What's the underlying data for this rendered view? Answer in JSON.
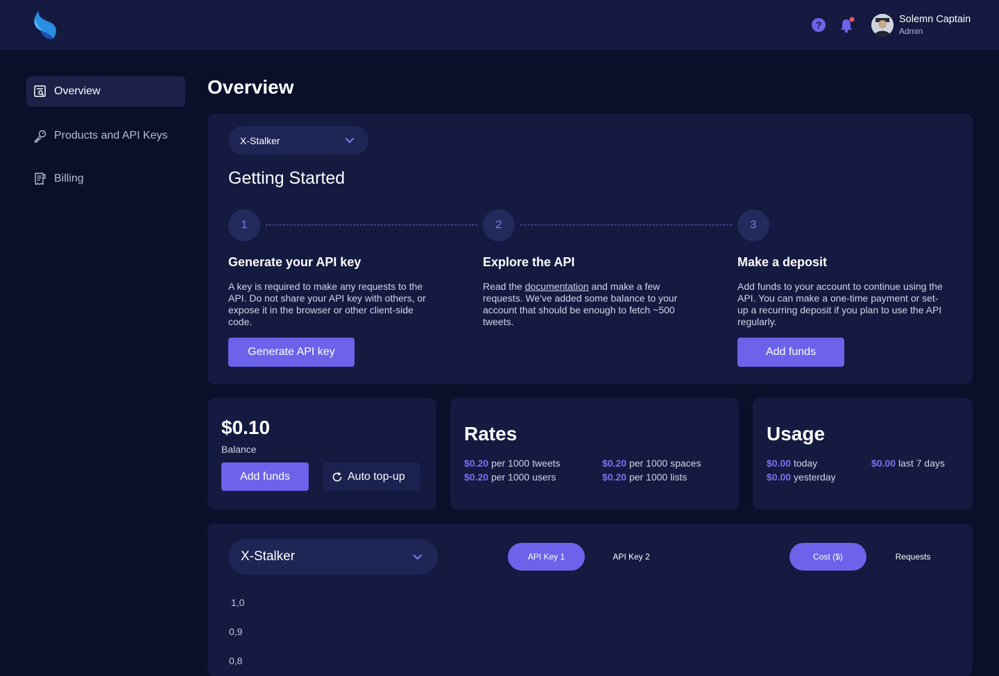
{
  "header": {
    "user_name": "Solemn Captain",
    "user_role": "Admin",
    "icons": [
      "app-logo",
      "help-icon",
      "bell-icon",
      "avatar"
    ]
  },
  "sidebar": {
    "items": [
      {
        "label": "Overview",
        "icon": "overview-icon",
        "active": true
      },
      {
        "label": "Products and API Keys",
        "icon": "key-icon",
        "active": false
      },
      {
        "label": "Billing",
        "icon": "receipt-icon",
        "active": false
      }
    ]
  },
  "page_title": "Overview",
  "getting_started": {
    "product_select": "X-Stalker",
    "title": "Getting Started",
    "steps": [
      {
        "number": "1",
        "title": "Generate your API key",
        "desc": "A key is required to make any requests to the API. Do not share your API key with others, or expose it in the browser or other client-side code.",
        "button": "Generate API key"
      },
      {
        "number": "2",
        "title": "Explore the API",
        "desc_before": "Read the ",
        "desc_link": "documentation",
        "desc_after": " and make a few requests. We've added some balance to your account that should be enough to fetch ~500 tweets."
      },
      {
        "number": "3",
        "title": "Make a deposit",
        "desc": "Add funds to your account to continue using the API. You can make a one-time payment or set-up a recurring deposit if you plan to use the API regularly.",
        "button": "Add funds"
      }
    ]
  },
  "balance": {
    "amount": "$0.10",
    "label": "Balance",
    "add_funds": "Add funds",
    "auto_topup": "Auto top-up"
  },
  "rates": {
    "title": "Rates",
    "items": [
      {
        "price": "$0.20",
        "unit": "per 1000 tweets"
      },
      {
        "price": "$0.20",
        "unit": "per 1000 spaces"
      },
      {
        "price": "$0.20",
        "unit": "per 1000 users"
      },
      {
        "price": "$0.20",
        "unit": "per 1000 lists"
      }
    ]
  },
  "usage": {
    "title": "Usage",
    "items": [
      {
        "value": "$0.00",
        "label": "today"
      },
      {
        "value": "$0.00",
        "label": "last 7 days"
      },
      {
        "value": "$0.00",
        "label": "yesterday"
      }
    ]
  },
  "chart_panel": {
    "product_select": "X-Stalker",
    "key_tabs": [
      {
        "label": "API Key 1",
        "active": true
      },
      {
        "label": "API Key 2",
        "active": false
      }
    ],
    "metric_tabs": [
      {
        "label": "Cost ($)",
        "active": true
      },
      {
        "label": "Requests",
        "active": false
      }
    ]
  },
  "chart_data": {
    "type": "line",
    "y_ticks": [
      "1,0",
      "0,9",
      "0,8"
    ],
    "series": []
  },
  "colors": {
    "background": "#0a0f2a",
    "card": "#141a40",
    "accent": "#6c63ea",
    "accent_text": "#7b72f2"
  }
}
